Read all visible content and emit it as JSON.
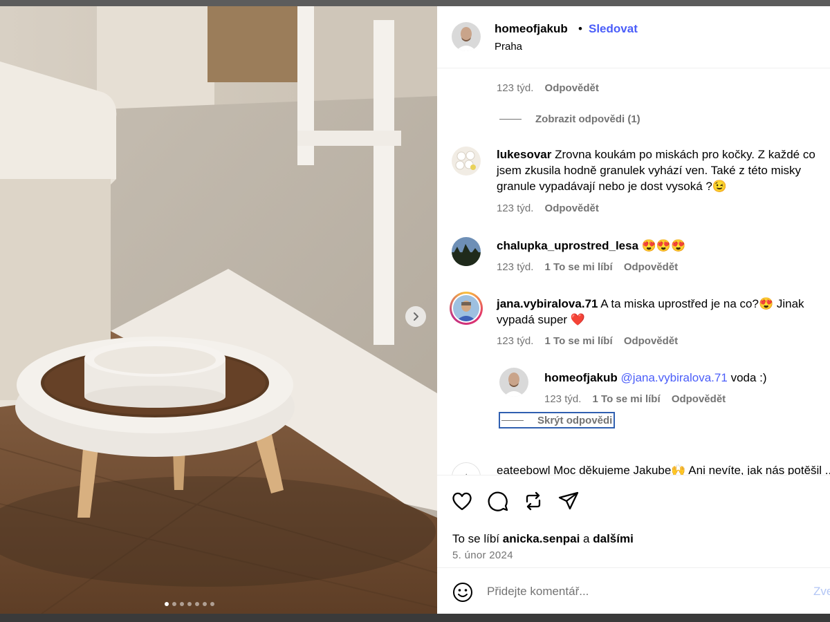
{
  "header": {
    "username": "homeofjakub",
    "separator": "•",
    "follow_label": "Sledovat",
    "location": "Praha"
  },
  "comments": {
    "first_meta": {
      "time": "123 týd.",
      "reply_label": "Odpovědět"
    },
    "view_replies_label": "Zobrazit odpovědi (1)",
    "items": [
      {
        "username": "lukesovar",
        "text": "Zrovna koukám po miskách pro kočky. Z každé co jsem zkusila hodně granulek vyhází ven. Také z této misky granule vypadávají nebo je dost vysoká ?😉",
        "time": "123 týd.",
        "reply_label": "Odpovědět"
      },
      {
        "username": "chalupka_uprostred_lesa",
        "text": "😍😍😍",
        "time": "123 týd.",
        "likes_label": "1 To se mi líbí",
        "reply_label": "Odpovědět"
      },
      {
        "username": "jana.vybiralova.71",
        "text": "A ta miska uprostřed je na co?😍 Jinak vypadá super ❤️",
        "time": "123 týd.",
        "likes_label": "1 To se mi líbí",
        "reply_label": "Odpovědět"
      },
      {
        "username": "eateebowl",
        "text": "Moc děkujeme Jakube🙌 Ani nevíte, jak nás potěšil ...",
        "avatar_text": "eatee"
      }
    ],
    "reply": {
      "username": "homeofjakub",
      "mention": "@jana.vybiralova.71",
      "text": "voda :)",
      "time": "123 týd.",
      "likes_label": "1 To se mi líbí",
      "reply_label": "Odpovědět"
    },
    "hide_replies_label": "Skrýt odpovědi"
  },
  "actions": {
    "icons": [
      "heart-icon",
      "comment-icon",
      "repost-icon",
      "share-icon"
    ],
    "likes_prefix": "To se líbí",
    "liked_by": "anicka.senpai",
    "likes_and": "a",
    "likes_others": "dalšími",
    "date": "5. únor 2024"
  },
  "add_comment": {
    "placeholder": "Přidejte komentář...",
    "post_label": "Zveřejnit"
  },
  "carousel": {
    "slide_count": 7,
    "active_index": 0
  },
  "colors": {
    "accent": "#4a5df9",
    "muted": "#737373",
    "focus_outline": "#2f5fb0"
  }
}
